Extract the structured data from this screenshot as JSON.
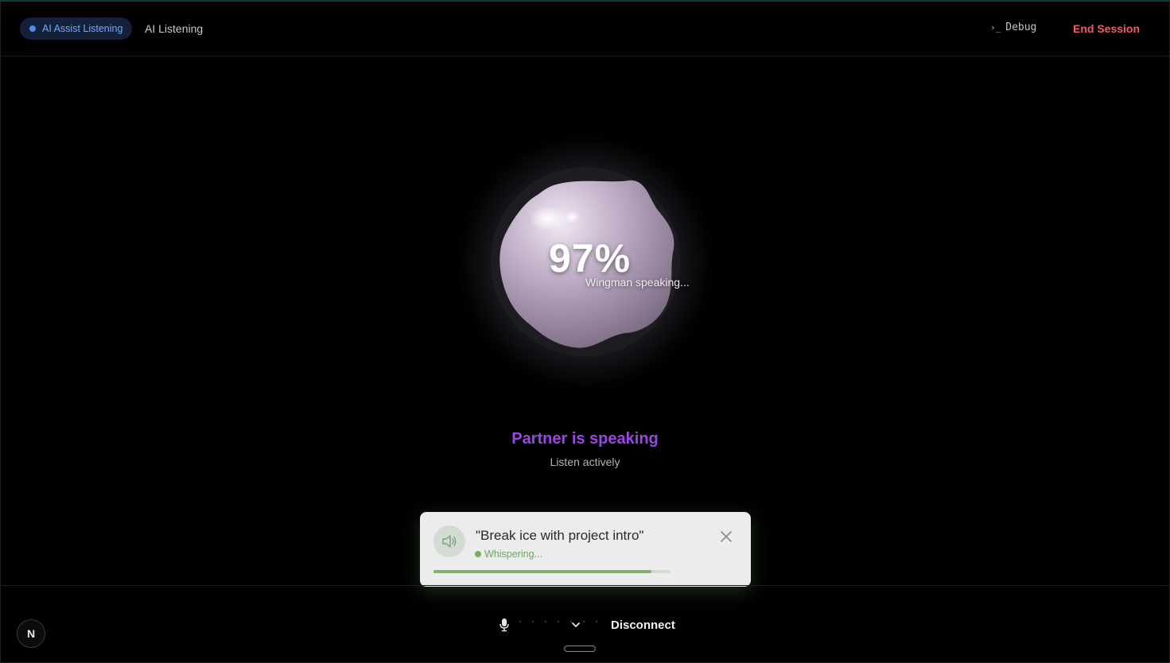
{
  "header": {
    "assist_pill_label": "AI Assist Listening",
    "mode_label": "AI Listening",
    "debug_icon": "terminal-icon",
    "debug_icon_glyph": "›_",
    "debug_label": "Debug",
    "end_session_label": "End Session"
  },
  "orb": {
    "percent": "97%",
    "status": "Wingman speaking..."
  },
  "partner": {
    "title": "Partner is speaking",
    "subtitle": "Listen actively"
  },
  "whisper": {
    "icon": "speaker-icon",
    "quote": "\"Break ice with project intro\"",
    "status": "Whispering...",
    "progress": 0.92
  },
  "bottom": {
    "mic_level_dots": "· · · · · · ·",
    "disconnect_label": "Disconnect",
    "logo_letter": "N"
  },
  "colors": {
    "accent_blue": "#4f8fe8",
    "end_session_red": "#ef5b6b",
    "partner_purple": "#9a46e6",
    "whisper_green": "#6fb25e"
  }
}
